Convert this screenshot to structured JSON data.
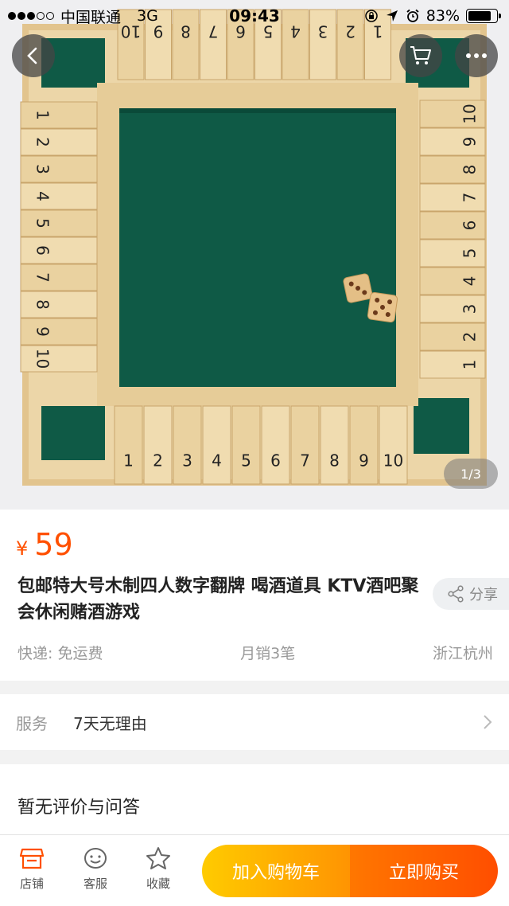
{
  "status_bar": {
    "carrier": "中国联通",
    "network": "3G",
    "time": "09:43",
    "battery": "83%",
    "battery_level": 0.83
  },
  "product": {
    "image_counter": "1/3",
    "currency": "¥",
    "price": "59",
    "title": "包邮特大号木制四人数字翻牌 喝酒道具 KTV酒吧聚会休闲赌酒游戏",
    "share_label": "分享",
    "shipping": "快递: 免运费",
    "monthly_sales": "月销3笔",
    "location": "浙江杭州",
    "board_numbers": [
      "1",
      "2",
      "3",
      "4",
      "5",
      "6",
      "7",
      "8",
      "9",
      "10"
    ]
  },
  "service": {
    "label": "服务",
    "value": "7天无理由"
  },
  "reviews": {
    "heading": "暂无评价与问答"
  },
  "bottom_bar": {
    "store": "店铺",
    "customer_service": "客服",
    "favorite": "收藏",
    "add_to_cart": "加入购物车",
    "buy_now": "立即购买"
  },
  "colors": {
    "accent": "#ff5000",
    "cart_button": "#ffa600",
    "buy_button": "#ff5a00",
    "felt": "#0f5a46",
    "wood": "#ecd6a8"
  },
  "icons": {
    "back": "chevron-left-icon",
    "cart": "cart-icon",
    "more": "more-icon",
    "share": "share-icon",
    "service_arrow": "chevron-right-icon",
    "store": "store-icon",
    "customer_service": "smile-face-icon",
    "favorite": "star-icon"
  }
}
